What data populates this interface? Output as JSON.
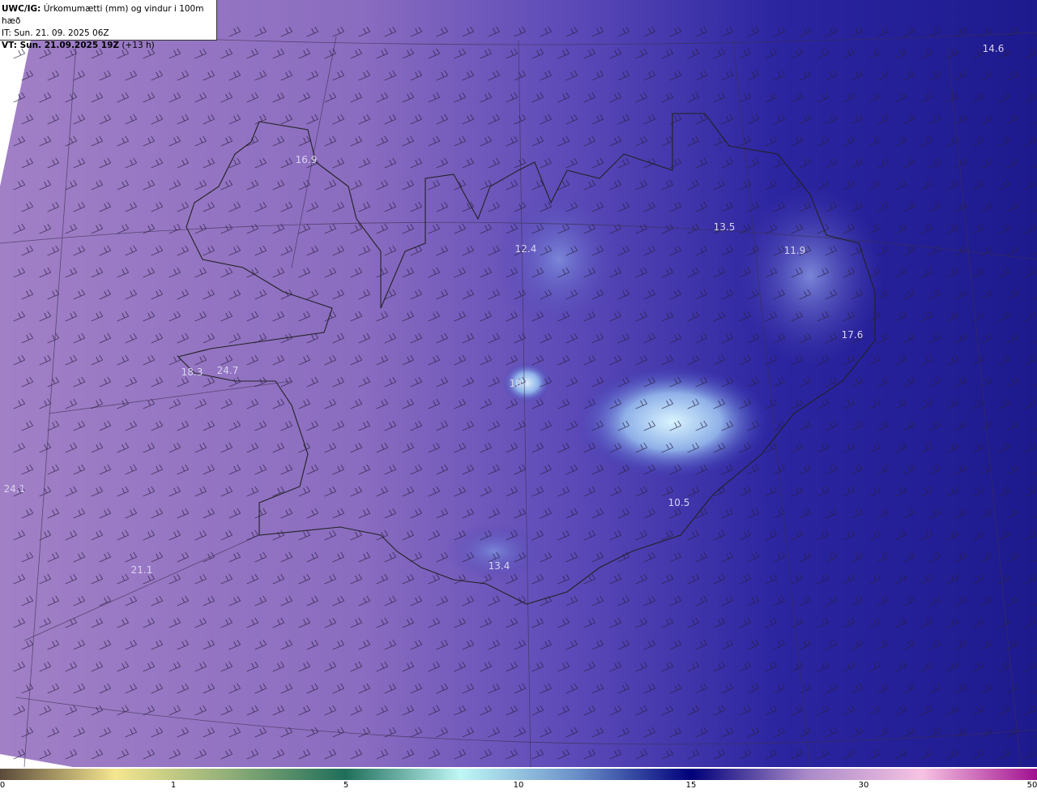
{
  "header": {
    "model": "UWC/IG:",
    "field": "Úrkomumætti (mm) og vindur i 100m hæð",
    "init_time": "IT: Sun. 21. 09. 2025 06Z",
    "valid_time_bold": "VT: Sun. 21.09.2025 19Z",
    "lead": "(+13 h)"
  },
  "map_labels": [
    {
      "text": "14.6"
    },
    {
      "text": "16.9"
    },
    {
      "text": "13.5"
    },
    {
      "text": "12.4"
    },
    {
      "text": "11.9"
    },
    {
      "text": "17.6"
    },
    {
      "text": "18.3"
    },
    {
      "text": "24.7"
    },
    {
      "text": "10.0"
    },
    {
      "text": "10.5"
    },
    {
      "text": "24.1"
    },
    {
      "text": "13.4"
    },
    {
      "text": "21.1"
    }
  ],
  "colorbar": {
    "ticks": [
      "0",
      "1",
      "5",
      "10",
      "15",
      "30",
      "50"
    ],
    "colors": [
      "#5a4a3a",
      "#f5e68f",
      "#8fae78",
      "#1f6e5a",
      "#bff7f5",
      "#6a8fc8",
      "#00007a",
      "#a98ac8",
      "#f7c3e3",
      "#a0108f"
    ]
  },
  "colors": {
    "west_field": "#9a7cc4",
    "east_field": "#1c1a8c",
    "coastline": "#222222"
  }
}
